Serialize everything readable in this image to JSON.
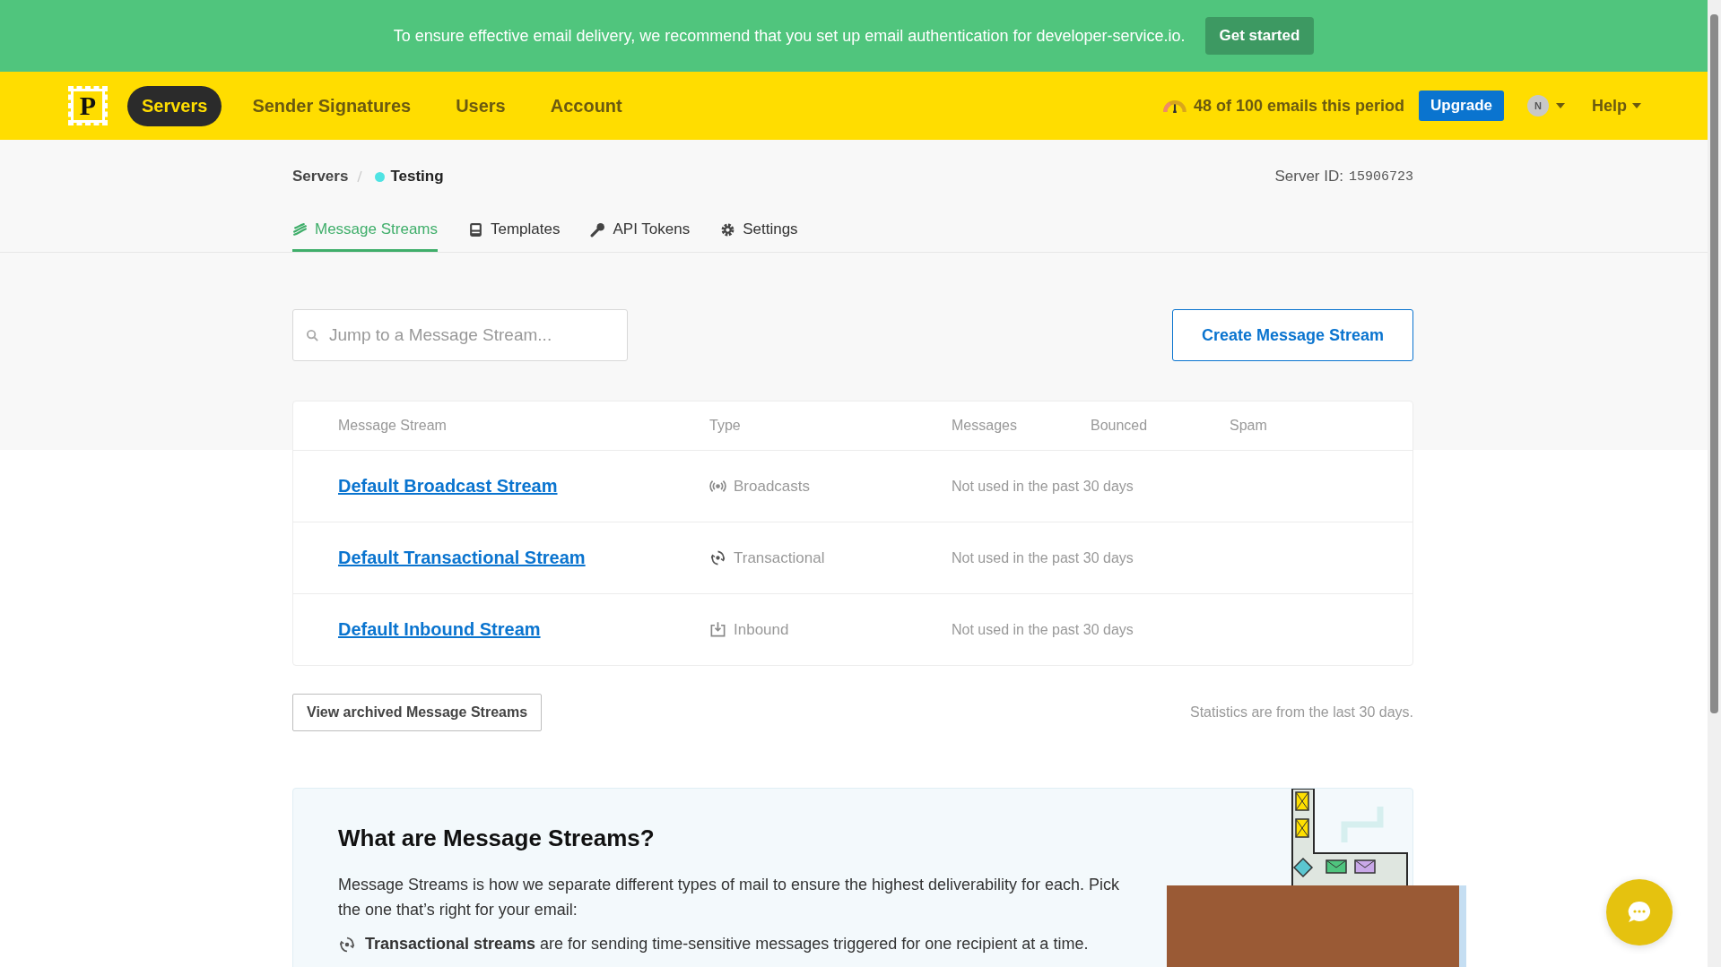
{
  "banner": {
    "message": "To ensure effective email delivery, we recommend that you set up email authentication for developer-service.io.",
    "button": "Get started"
  },
  "nav": {
    "logo": "P",
    "items": [
      {
        "label": "Servers",
        "selected": true
      },
      {
        "label": "Sender Signatures",
        "selected": false
      },
      {
        "label": "Users",
        "selected": false
      },
      {
        "label": "Account",
        "selected": false
      }
    ],
    "usage": "48 of 100 emails this period",
    "upgrade": "Upgrade",
    "avatar": "N",
    "help": "Help"
  },
  "breadcrumb": {
    "parent": "Servers",
    "current": "Testing",
    "color": "#4fe3e3"
  },
  "server_id": {
    "label": "Server ID:",
    "value": "15906723"
  },
  "tabs": [
    {
      "label": "Message Streams",
      "kind": "streams",
      "selected": true
    },
    {
      "label": "Templates",
      "kind": "templates",
      "selected": false
    },
    {
      "label": "API Tokens",
      "kind": "key",
      "selected": false
    },
    {
      "label": "Settings",
      "kind": "gear",
      "selected": false
    }
  ],
  "search": {
    "placeholder": "Jump to a Message Stream..."
  },
  "create_button": "Create Message Stream",
  "table": {
    "columns": [
      "Message Stream",
      "Type",
      "Messages",
      "Bounced",
      "Spam"
    ],
    "rows": [
      {
        "name": "Default Broadcast Stream",
        "type": "Broadcasts",
        "kind": "broadcast",
        "messages": "Not used in the past 30 days"
      },
      {
        "name": "Default Transactional Stream",
        "type": "Transactional",
        "kind": "transactional",
        "messages": "Not used in the past 30 days"
      },
      {
        "name": "Default Inbound Stream",
        "type": "Inbound",
        "kind": "inbound",
        "messages": "Not used in the past 30 days"
      }
    ]
  },
  "archived_button": "View archived Message Streams",
  "stats_note": "Statistics are from the last 30 days.",
  "info": {
    "title": "What are Message Streams?",
    "text": "Message Streams is how we separate different types of mail to ensure the highest deliverability for each. Pick the one that’s right for your email:",
    "items": [
      {
        "kind": "transactional",
        "text": "**Transactional streams** are for sending time-sensitive messages triggered for one recipient at a time."
      }
    ]
  }
}
